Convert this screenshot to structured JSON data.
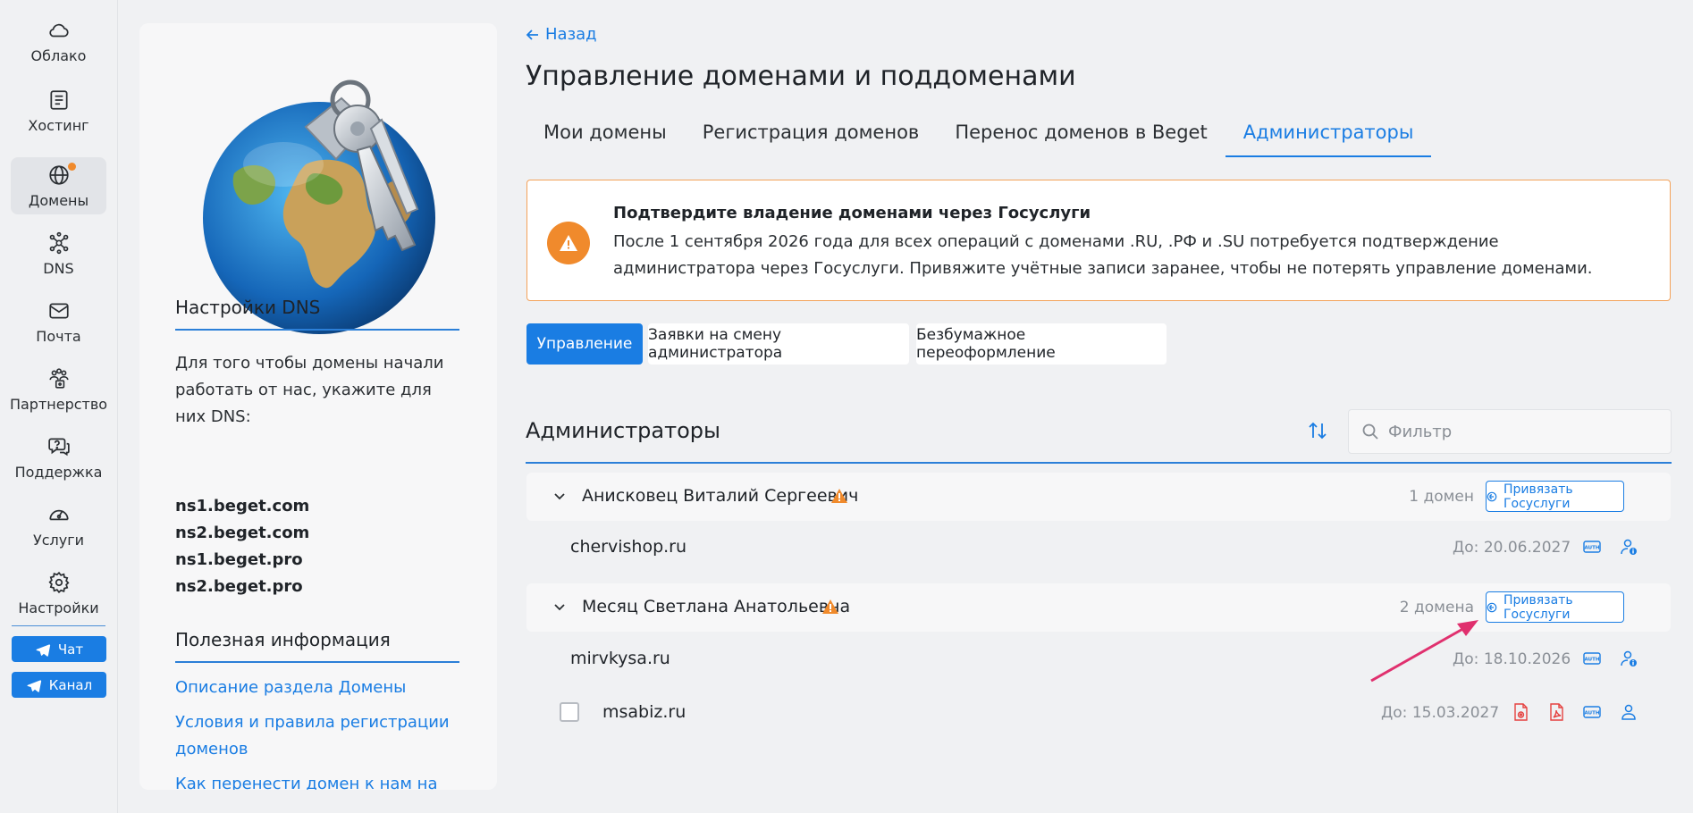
{
  "nav": {
    "items": [
      {
        "label": "Облако",
        "icon": "cloud-icon"
      },
      {
        "label": "Хостинг",
        "icon": "server-icon"
      },
      {
        "label": "Домены",
        "icon": "globe-icon"
      },
      {
        "label": "DNS",
        "icon": "dns-network-icon"
      },
      {
        "label": "Почта",
        "icon": "mail-icon"
      },
      {
        "label": "Партнерство",
        "icon": "partners-icon"
      },
      {
        "label": "Поддержка",
        "icon": "support-chat-icon"
      },
      {
        "label": "Услуги",
        "icon": "services-gauge-icon"
      },
      {
        "label": "Настройки",
        "icon": "settings-gear-icon"
      }
    ],
    "active": "Домены",
    "chat_label": "Чат",
    "channel_label": "Канал"
  },
  "side": {
    "dns_title": "Настройки DNS",
    "dns_text": "Для того чтобы домены начали работать от нас, укажите для них DNS:",
    "ns": [
      "ns1.beget.com",
      "ns2.beget.com",
      "ns1.beget.pro",
      "ns2.beget.pro"
    ],
    "info_title": "Полезная информация",
    "links": [
      "Описание раздела Домены",
      "Условия и правила регистрации доменов",
      "Как перенести домен к нам на"
    ]
  },
  "main": {
    "back_label": "Назад",
    "title": "Управление доменами и поддоменами",
    "tabs": [
      "Мои домены",
      "Регистрация доменов",
      "Перенос доменов в Beget",
      "Администраторы"
    ],
    "active_tab": "Администраторы",
    "alert": {
      "title": "Подтвердите владение доменами через Госуслуги",
      "text": "После 1 сентября 2026 года для всех операций с доменами .RU, .РФ и .SU потребуется подтверждение администратора через Госуслуги. Привяжите учётные записи заранее, чтобы не потерять управление доменами."
    },
    "segments": [
      "Управление",
      "Заявки на смену администратора",
      "Безбумажное переоформление"
    ],
    "active_segment": "Управление",
    "section_title": "Администраторы",
    "filter_placeholder": "Фильтр",
    "groups": [
      {
        "name": "Анисковец Виталий Сергеевич",
        "count": "1 домен",
        "button": "Привязать Госуслуги",
        "domains": [
          {
            "name": "chervishop.ru",
            "date": "До: 20.06.2027"
          }
        ]
      },
      {
        "name": "Месяц Светлана Анатольевна",
        "count": "2 домена",
        "button": "Привязать Госуслуги",
        "domains": [
          {
            "name": "mirvkysa.ru",
            "date": "До: 18.10.2026"
          },
          {
            "name": "msabiz.ru",
            "date": "До: 15.03.2027"
          }
        ]
      }
    ]
  },
  "colors": {
    "accent": "#1a7de3",
    "warning": "#f08a2c",
    "annotation_arrow": "#e0306e"
  }
}
